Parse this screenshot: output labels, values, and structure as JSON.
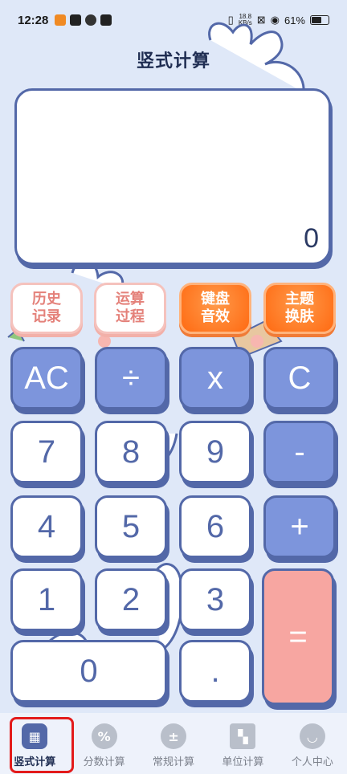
{
  "status": {
    "time": "12:28",
    "net_speed": "18.8",
    "net_unit": "KB/s",
    "battery": "61%"
  },
  "title": "竖式计算",
  "display": {
    "value": "0"
  },
  "func_buttons": {
    "history": "历史\n记录",
    "process": "运算\n过程",
    "keyboard_sound": "键盘\n音效",
    "theme": "主题\n换肤"
  },
  "keys": {
    "ac": "AC",
    "divide": "÷",
    "multiply": "x",
    "clear": "C",
    "seven": "7",
    "eight": "8",
    "nine": "9",
    "minus": "-",
    "four": "4",
    "five": "5",
    "six": "6",
    "plus": "+",
    "one": "1",
    "two": "2",
    "three": "3",
    "equals": "=",
    "zero": "0",
    "dot": "."
  },
  "tabs": [
    {
      "label": "竖式计算",
      "icon": "calculator-icon",
      "active": true
    },
    {
      "label": "分数计算",
      "icon": "percent-icon"
    },
    {
      "label": "常规计算",
      "icon": "operators-icon"
    },
    {
      "label": "单位计算",
      "icon": "unit-grid-icon"
    },
    {
      "label": "个人中心",
      "icon": "smile-icon"
    }
  ],
  "colors": {
    "accent": "#5368a8",
    "key_blue": "#7d95dc",
    "key_red": "#f7a6a1",
    "orange": "#ff6a12",
    "pink_text": "#e4817a",
    "highlight": "#e31b1b"
  }
}
